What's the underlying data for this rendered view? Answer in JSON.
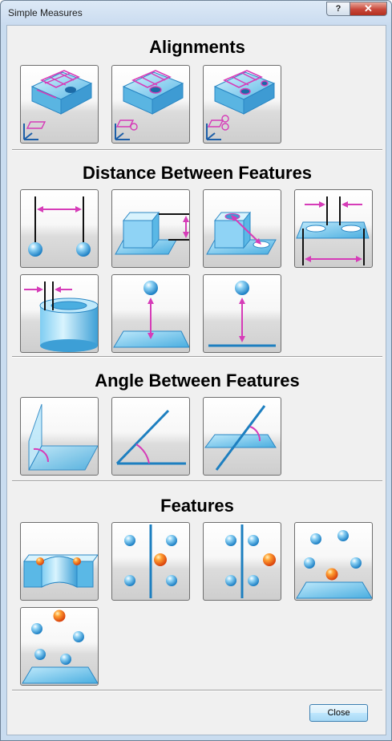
{
  "window": {
    "title": "Simple Measures",
    "help_glyph": "?",
    "close_glyph": "✕"
  },
  "sections": {
    "alignments": "Alignments",
    "distance": "Distance Between Features",
    "angle": "Angle Between Features",
    "features": "Features"
  },
  "tiles": {
    "alignments": [
      "alignment-plane",
      "alignment-plane-circle",
      "alignment-plane-two-circles"
    ],
    "distance": [
      "distance-point-point",
      "distance-plane-plane",
      "distance-circle-circle",
      "distance-cylinder-cylinder",
      "distance-circle-cylinder",
      "distance-point-plane",
      "distance-point-line"
    ],
    "angle": [
      "angle-plane-plane",
      "angle-line-line",
      "angle-line-plane"
    ],
    "features": [
      "feature-cylinder",
      "feature-points-line",
      "feature-points-line-2",
      "feature-points-plane",
      "feature-points-plane-2"
    ]
  },
  "colors": {
    "accent": "#d63cb8",
    "feature_blue": "#4aaee0",
    "point_orange": "#f07820",
    "axis_blue": "#1d5fa8"
  },
  "footer": {
    "close_label": "Close"
  }
}
